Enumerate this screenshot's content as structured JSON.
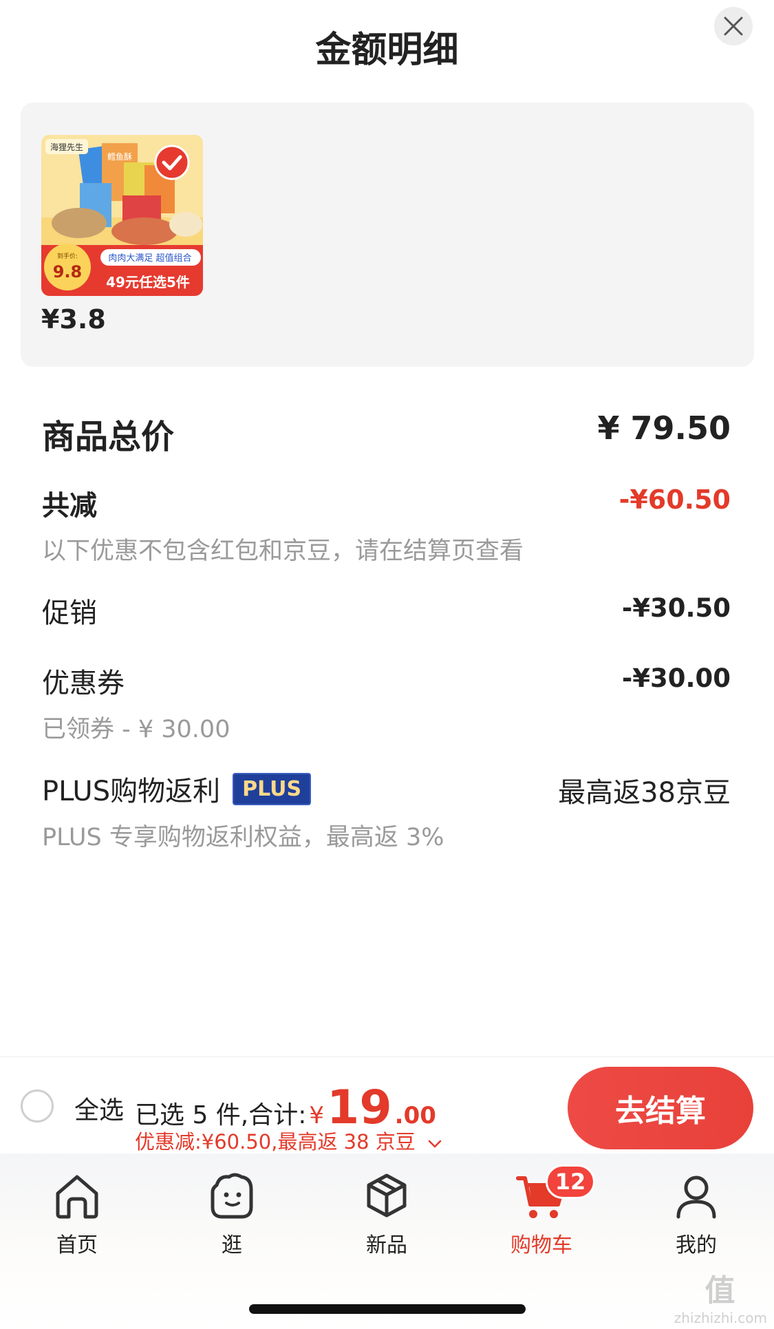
{
  "header": {
    "title": "金额明细"
  },
  "product": {
    "price": "¥3.8",
    "thumb": {
      "brand": "海狸先生",
      "product_name": "鳕鱼酥",
      "tagline": "肉肉大满足 超值组合",
      "hand_price_label": "到手价:",
      "hand_price": "9.8",
      "promo": "49元任选5件"
    }
  },
  "summary": {
    "total_label": "商品总价",
    "total_value": "¥ 79.50",
    "discount_label": "共减",
    "discount_value": "-¥60.50",
    "discount_note": "以下优惠不包含红包和京豆，请在结算页查看",
    "promo_label": "促销",
    "promo_value": "-¥30.50",
    "coupon_label": "优惠券",
    "coupon_value": "-¥30.00",
    "coupon_note": "已领券 - ¥ 30.00",
    "plus_label": "PLUS购物返利",
    "plus_badge": "PLUS",
    "plus_value": "最高返38京豆",
    "plus_note": "PLUS 专享购物返利权益，最高返 3%"
  },
  "checkout": {
    "select_all": "全选",
    "selected_text": "已选 5 件,合计:",
    "currency": "¥",
    "total_int": "19",
    "total_dec": ".00",
    "discount_line": "优惠减:¥60.50,最高返 38 京豆",
    "pay_button": "去结算"
  },
  "tabs": [
    {
      "label": "首页",
      "icon": "home-icon"
    },
    {
      "label": "逛",
      "icon": "stroll-face-icon"
    },
    {
      "label": "新品",
      "icon": "cube-icon"
    },
    {
      "label": "购物车",
      "icon": "cart-icon",
      "badge": "12",
      "active": true
    },
    {
      "label": "我的",
      "icon": "person-icon"
    }
  ],
  "watermark": {
    "text": "值",
    "url": "zhizhizhi.com"
  },
  "colors": {
    "accent": "#e33a2a",
    "plus_badge": "#1f3f9a"
  }
}
